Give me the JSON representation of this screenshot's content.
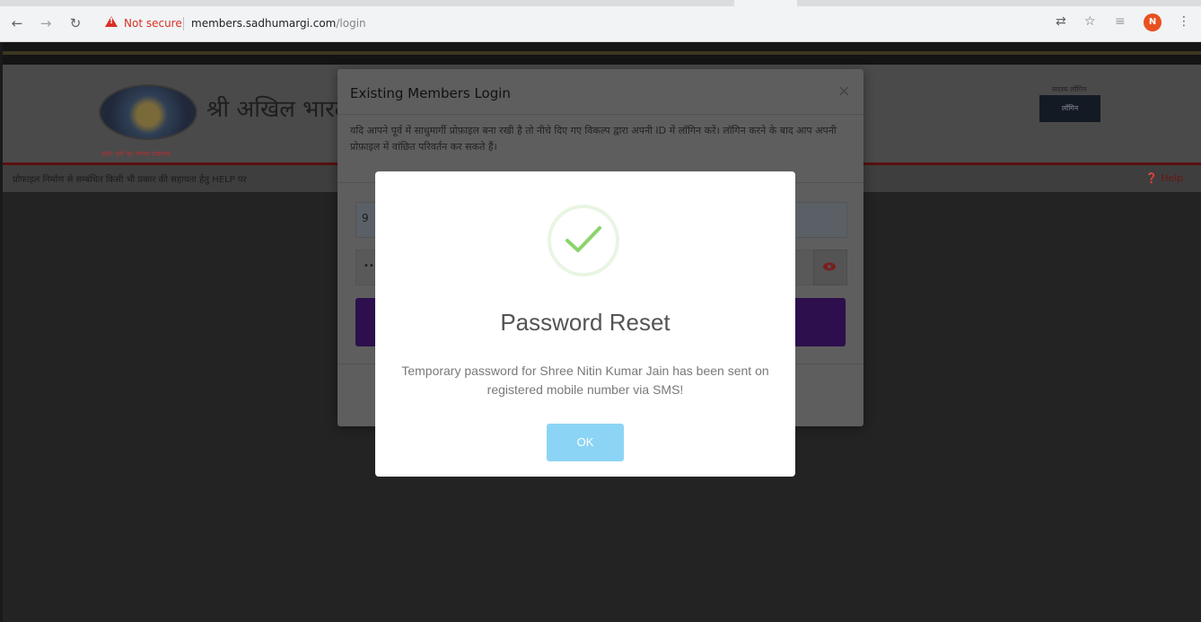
{
  "browser": {
    "security_label": "Not secure",
    "url_host": "members.sadhumargi.com",
    "url_path": "/login",
    "profile_initial": "N"
  },
  "site": {
    "title_fragment": "श्री अखिल भारतव",
    "logo_caption": "सत्य धर्म का सच्चा प्रचारक",
    "header_small_text": "सदस्य लॉगिन",
    "login_button": "लॉगिन",
    "notice_text": "प्रोफाइल निर्माण से सम्बंधित किसी भी प्रकार की सहायता हेतु HELP पर",
    "help_link": "Help"
  },
  "login_modal": {
    "title": "Existing Members Login",
    "close": "×",
    "description": "यदि आपने पूर्व में साधुमार्गी प्रोफ़ाइल बना रखी है तो नीचे दिए गए विकल्प द्वारा अपनी ID में लॉगिन करें। लॉगिन करने के बाद आप अपनी प्रोफ़ाइल में वांछित परिवर्तन कर सकते हैं।",
    "username_value": "9",
    "password_value": "••"
  },
  "alert": {
    "title": "Password Reset",
    "message": "Temporary password for Shree Nitin Kumar Jain has been sent on registered mobile number via SMS!",
    "ok_label": "OK"
  },
  "colors": {
    "success_check": "#8bd46b",
    "ok_button": "#8cd4f5",
    "security_red": "#d93025"
  }
}
